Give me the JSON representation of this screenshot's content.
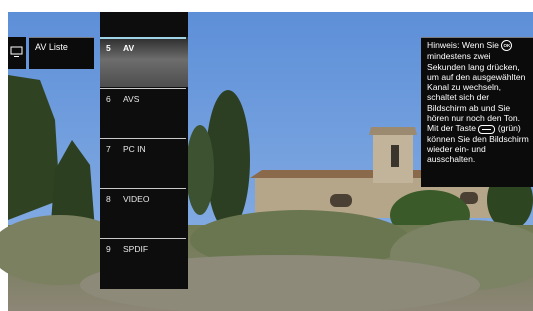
{
  "header": {
    "list_title": "AV Liste"
  },
  "channels": [
    {
      "number": "5",
      "name": "AV",
      "selected": true
    },
    {
      "number": "6",
      "name": "AVS",
      "selected": false
    },
    {
      "number": "7",
      "name": "PC IN",
      "selected": false
    },
    {
      "number": "8",
      "name": "VIDEO",
      "selected": false
    },
    {
      "number": "9",
      "name": "SPDIF",
      "selected": false
    }
  ],
  "hint": {
    "part1": "Hinweis: Wenn Sie",
    "ok_icon": "OK",
    "part2": "mindestens zwei Sekunden lang drücken, um auf den ausgewählten Kanal zu wechseln, schaltet sich der Bildschirm ab und Sie hören nur noch den Ton.",
    "part3": "Mit der Taste",
    "part4": "(grün) können Sie den Bildschirm wieder ein- und ausschalten."
  },
  "icons": {
    "tv": "tv-icon",
    "ok": "ok-button-icon",
    "green": "green-key-icon"
  },
  "colors": {
    "panel": "#0d0d0d",
    "selected_accent": "#9fd4e6",
    "text": "#ffffff"
  }
}
